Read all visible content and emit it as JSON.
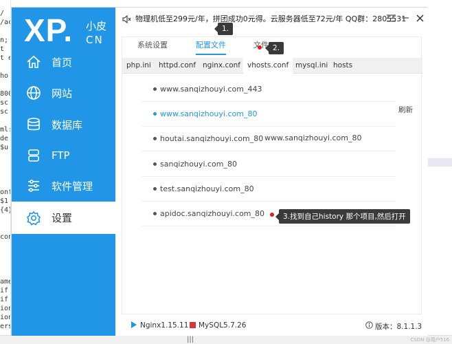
{
  "background": {
    "code_lines": [
      "/",
      "/ac",
      "",
      "n;",
      "t",
      "t e",
      "",
      " ho",
      "",
      "800",
      " sc",
      " sc",
      "",
      "ml:",
      " de",
      " $u",
      "",
      "",
      "",
      "",
      "onf",
      " $1",
      "{4}",
      "",
      "",
      "con",
      "",
      "",
      "",
      "",
      "ame",
      "if",
      "if",
      "ion",
      "ion",
      "ers"
    ],
    "grip": "|||",
    "watermark": "CSDN @用户516"
  },
  "app": {
    "logo": {
      "xp": "XP.",
      "cn_top": "小皮",
      "cn_bottom": "CN"
    },
    "nav": [
      {
        "label": "首页",
        "icon": "home-icon"
      },
      {
        "label": "网站",
        "icon": "globe-icon"
      },
      {
        "label": "数据库",
        "icon": "database-icon"
      },
      {
        "label": "FTP",
        "icon": "server-icon"
      },
      {
        "label": "软件管理",
        "icon": "sliders-icon"
      },
      {
        "label": "设置",
        "icon": "gear-icon",
        "active": true
      }
    ],
    "notice": "物理机低至299元/年，拼团成功0元得。云服务器低至72元/年  QQ群：2805531",
    "window_controls": {
      "menu": "☰",
      "minimize": "—",
      "close": "✕"
    },
    "tabs": [
      {
        "label": "系统设置"
      },
      {
        "label": "配置文件",
        "active": true
      },
      {
        "label": "文件"
      }
    ],
    "subtabs": [
      {
        "label": "php.ini"
      },
      {
        "label": "httpd.conf"
      },
      {
        "label": "nginx.conf"
      },
      {
        "label": "vhosts.conf",
        "active": true
      },
      {
        "label": "mysql.ini"
      },
      {
        "label": "hosts"
      }
    ],
    "hosts": [
      {
        "label": "www.sanqizhouyi.com_443"
      },
      {
        "label": "www.sanqizhouyi.com_80",
        "selected": true
      },
      {
        "label": "houtai.sanqizhouyi.com_80"
      },
      {
        "label": "sanqizhouyi.com_80"
      },
      {
        "label": "test.sanqizhouyi.com_80"
      },
      {
        "label": "apidoc.sanqizhouyi.com_80"
      }
    ],
    "refresh_label": "刷新",
    "floating_label": "www.sanqizhouyi.com_80",
    "status": {
      "nginx": "Nginx1.15.11",
      "mysql": "MySQL5.7.26",
      "version": "版本：8.1.1.3"
    },
    "colors": {
      "accent": "#2196e7",
      "marker": "#e02020",
      "callout_bg": "#3a3a3a",
      "mysql_square": "#d9333f"
    }
  },
  "annotations": {
    "step1": "1.",
    "step2": "2.",
    "step3": "3.找到自己history 那个项目,然后打开"
  }
}
